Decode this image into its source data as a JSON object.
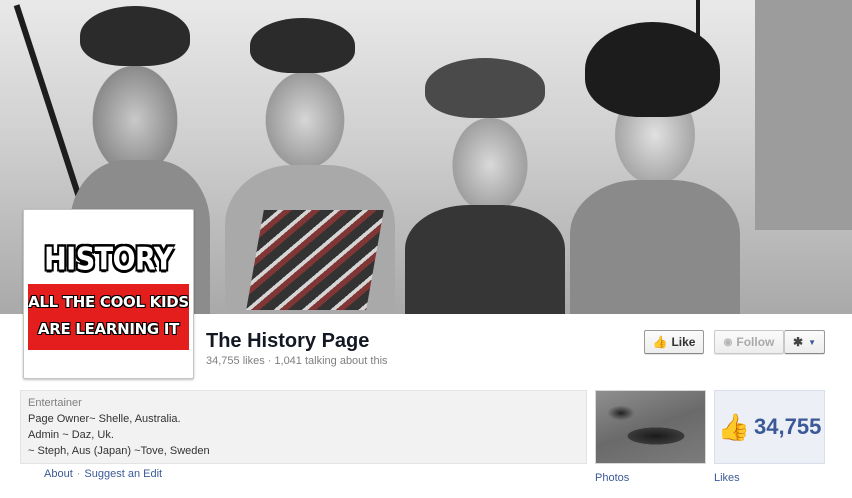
{
  "page": {
    "name": "The History Page",
    "likes": "34,755 likes",
    "separator": "·",
    "talking": "1,041 talking about this"
  },
  "logo": {
    "title": "HISTORY",
    "line1": "ALL THE COOL KIDS",
    "line2": "ARE LEARNING IT",
    "band_color": "#e41d1d"
  },
  "actions": {
    "like_label": "Like",
    "like_icon": "thumbs-up-icon",
    "follow_label": "Follow",
    "follow_icon": "rss-icon",
    "settings_icon": "gear-icon",
    "settings_caret": "caret-down-icon"
  },
  "about": {
    "category": "Entertainer",
    "lines": [
      "Page Owner~ Shelle, Australia.",
      "Admin ~ Daz, Uk.",
      "~ Steph, Aus (Japan) ~Tove, Sweden"
    ],
    "about_link": "About",
    "link_separator": "·",
    "suggest_link": "Suggest an Edit"
  },
  "apps": {
    "photos_label": "Photos",
    "likes_label": "Likes",
    "likes_count": "34,755",
    "likes_icon": "thumbs-up-icon"
  },
  "colors": {
    "link": "#3b5998",
    "title": "#141823",
    "muted": "#7f7f7f"
  }
}
